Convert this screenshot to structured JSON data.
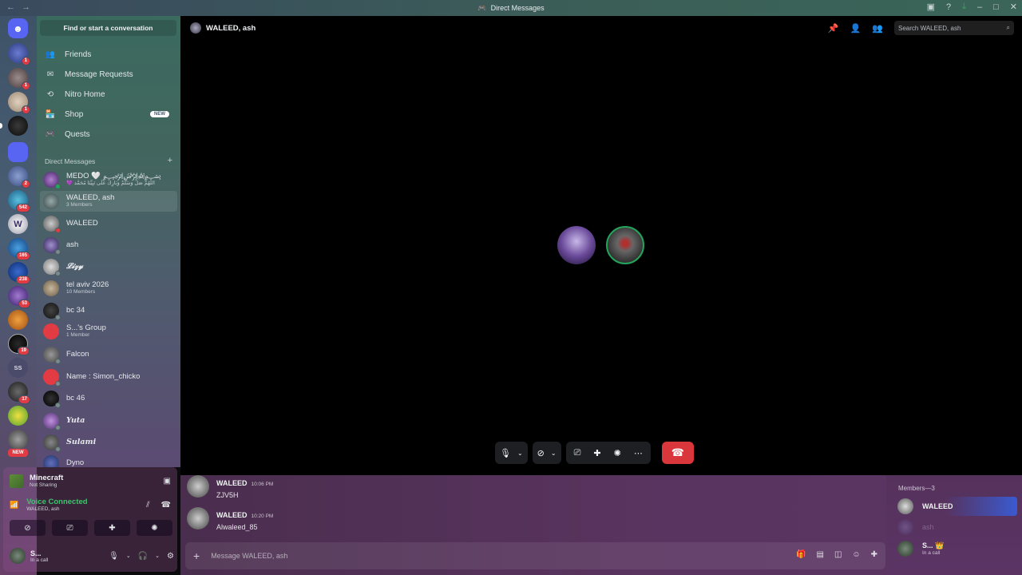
{
  "titlebar": {
    "title": "Direct Messages"
  },
  "rail": {
    "badges": [
      "1",
      "1",
      "1",
      "2",
      "542",
      "165",
      "238",
      "53",
      "19",
      "17"
    ],
    "ss_label": "SS",
    "new_label": "NEW"
  },
  "sidebar": {
    "search": "Find or start a conversation",
    "nav": [
      {
        "label": "Friends",
        "icon": "friends-icon"
      },
      {
        "label": "Message Requests",
        "icon": "mail-icon"
      },
      {
        "label": "Nitro Home",
        "icon": "nitro-icon"
      },
      {
        "label": "Shop",
        "icon": "shop-icon",
        "badge": "NEW"
      },
      {
        "label": "Quests",
        "icon": "quests-icon"
      }
    ],
    "dm_header": "Direct Messages",
    "dms": [
      {
        "name": "MEDO 🤍 ﷽",
        "sub": "💜 اللَّهُمَّ صَلِّ وَسَلِّمْ وَبَارِكْ عَلَى نَبِيِّنَا مُحَمَّد"
      },
      {
        "name": "WALEED, ash",
        "sub": "3 Members"
      },
      {
        "name": "WALEED",
        "sub": ""
      },
      {
        "name": "ash",
        "sub": ""
      },
      {
        "name": "𝓛𝓲𝔃𝔂",
        "sub": ""
      },
      {
        "name": "tel aviv 2026",
        "sub": "10 Members"
      },
      {
        "name": "bc 34",
        "sub": ""
      },
      {
        "name": "S...'s Group",
        "sub": "1 Member"
      },
      {
        "name": "Falcon",
        "sub": ""
      },
      {
        "name": "Name : Simon_chicko",
        "sub": ""
      },
      {
        "name": "bc 46",
        "sub": ""
      },
      {
        "name": "Yuta",
        "sub": ""
      },
      {
        "name": "Sulami",
        "sub": ""
      },
      {
        "name": "Dyno",
        "sub": ""
      }
    ]
  },
  "userpanel": {
    "activity_title": "Minecraft",
    "activity_sub": "Not Sharing",
    "voice_title": "Voice Connected",
    "voice_sub": "WALEED, ash",
    "user_name": "S...",
    "user_status": "In a call"
  },
  "main": {
    "header_title": "WALEED, ash",
    "search_placeholder": "Search WALEED, ash"
  },
  "chat": {
    "messages": [
      {
        "author": "WALEED",
        "time": "10:06 PM",
        "text": "ZJV5H"
      },
      {
        "author": "WALEED",
        "time": "10:20 PM",
        "text": "Alwaleed_85"
      }
    ],
    "composer_placeholder": "Message WALEED, ash"
  },
  "members": {
    "header": "Members—3",
    "list": [
      {
        "name": "WALEED",
        "sub": ""
      },
      {
        "name": "ash",
        "sub": ""
      },
      {
        "name": "S... 👑",
        "sub": "In a call"
      }
    ]
  },
  "colors": {
    "hangup": "#da373c",
    "accent": "#5865f2",
    "online": "#23a55a"
  }
}
